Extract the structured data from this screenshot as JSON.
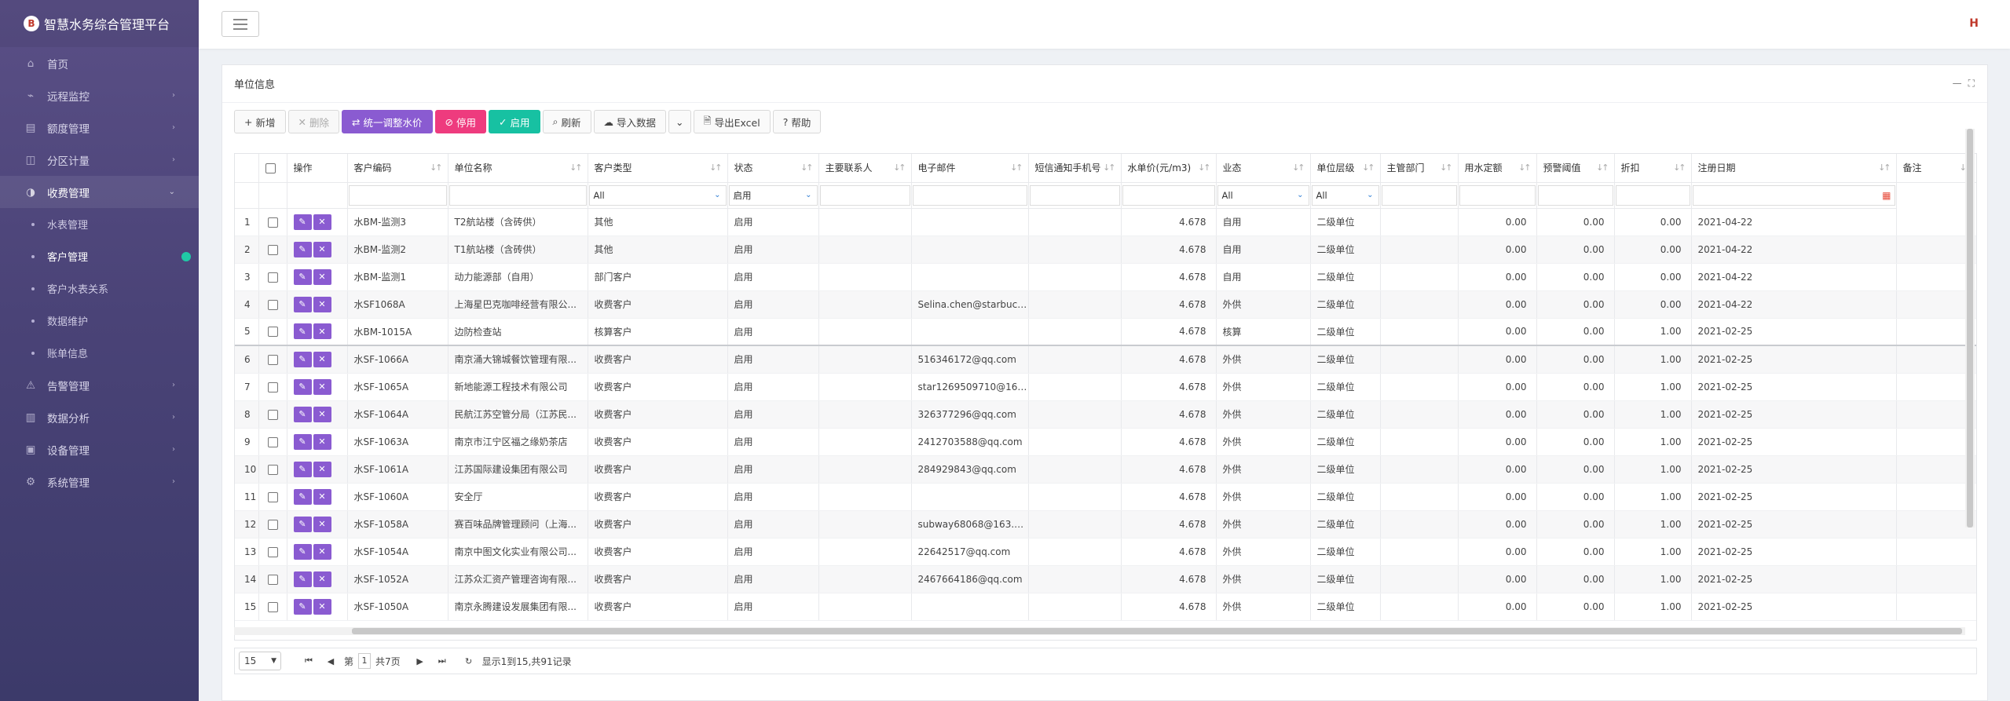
{
  "app": {
    "title": "智慧水务综合管理平台",
    "logo_text": "B"
  },
  "sidebar": {
    "items": [
      {
        "label": "首页",
        "icon": "home-icon"
      },
      {
        "label": "远程监控",
        "icon": "monitor-icon"
      },
      {
        "label": "额度管理",
        "icon": "quota-icon"
      },
      {
        "label": "分区计量",
        "icon": "partition-icon"
      },
      {
        "label": "收费管理",
        "icon": "billing-icon",
        "open": true,
        "children": [
          {
            "label": "水表管理"
          },
          {
            "label": "客户管理",
            "active": true
          },
          {
            "label": "客户水表关系"
          },
          {
            "label": "数据维护"
          },
          {
            "label": "账单信息"
          }
        ]
      },
      {
        "label": "告警管理",
        "icon": "alarm-icon"
      },
      {
        "label": "数据分析",
        "icon": "analysis-icon"
      },
      {
        "label": "设备管理",
        "icon": "device-icon"
      },
      {
        "label": "系统管理",
        "icon": "system-icon"
      }
    ]
  },
  "panel": {
    "title": "单位信息"
  },
  "toolbar": {
    "add": "新增",
    "delete": "删除",
    "adjust_price": "统一调整水价",
    "disable": "停用",
    "enable": "启用",
    "refresh": "刷新",
    "import": "导入数据",
    "export": "导出Excel",
    "help": "帮助"
  },
  "table": {
    "columns": [
      "操作",
      "客户编码",
      "单位名称",
      "客户类型",
      "状态",
      "主要联系人",
      "电子邮件",
      "短信通知手机号",
      "水单价(元/m3)",
      "业态",
      "单位层级",
      "主管部门",
      "用水定额",
      "预警阈值",
      "折扣",
      "注册日期",
      "备注"
    ],
    "filters": {
      "customer_type": "All",
      "status": "启用",
      "business_type": "All",
      "unit_level": "All"
    },
    "rows": [
      {
        "no": "1",
        "code": "水BM-监测3",
        "name": "T2航站楼（含砖供）",
        "type": "其他",
        "status": "启用",
        "email": "",
        "price": "4.678",
        "biz": "自用",
        "level": "二级单位",
        "quota": "0.00",
        "warn": "0.00",
        "discount": "0.00",
        "date": "2021-04-22"
      },
      {
        "no": "2",
        "code": "水BM-监测2",
        "name": "T1航站楼（含砖供）",
        "type": "其他",
        "status": "启用",
        "email": "",
        "price": "4.678",
        "biz": "自用",
        "level": "二级单位",
        "quota": "0.00",
        "warn": "0.00",
        "discount": "0.00",
        "date": "2021-04-22"
      },
      {
        "no": "3",
        "code": "水BM-监测1",
        "name": "动力能源部（自用）",
        "type": "部门客户",
        "status": "启用",
        "email": "",
        "price": "4.678",
        "biz": "自用",
        "level": "二级单位",
        "quota": "0.00",
        "warn": "0.00",
        "discount": "0.00",
        "date": "2021-04-22"
      },
      {
        "no": "4",
        "code": "水SF1068A",
        "name": "上海星巴克咖啡经营有限公...",
        "type": "收费客户",
        "status": "启用",
        "email": "Selina.chen@starbuck...",
        "price": "4.678",
        "biz": "外供",
        "level": "二级单位",
        "quota": "0.00",
        "warn": "0.00",
        "discount": "0.00",
        "date": "2021-04-22"
      },
      {
        "no": "5",
        "code": "水BM-1015A",
        "name": "边防检查站",
        "type": "核算客户",
        "status": "启用",
        "email": "",
        "price": "4.678",
        "biz": "核算",
        "level": "二级单位",
        "quota": "0.00",
        "warn": "0.00",
        "discount": "1.00",
        "date": "2021-02-25"
      },
      {
        "no": "6",
        "code": "水SF-1066A",
        "name": "南京涌大锦城餐饮管理有限...",
        "type": "收费客户",
        "status": "启用",
        "email": "516346172@qq.com",
        "price": "4.678",
        "biz": "外供",
        "level": "二级单位",
        "quota": "0.00",
        "warn": "0.00",
        "discount": "1.00",
        "date": "2021-02-25"
      },
      {
        "no": "7",
        "code": "水SF-1065A",
        "name": "新地能源工程技术有限公司",
        "type": "收费客户",
        "status": "启用",
        "email": "star1269509710@163...",
        "price": "4.678",
        "biz": "外供",
        "level": "二级单位",
        "quota": "0.00",
        "warn": "0.00",
        "discount": "1.00",
        "date": "2021-02-25"
      },
      {
        "no": "8",
        "code": "水SF-1064A",
        "name": "民航江苏空管分局（江苏民...",
        "type": "收费客户",
        "status": "启用",
        "email": "326377296@qq.com",
        "price": "4.678",
        "biz": "外供",
        "level": "二级单位",
        "quota": "0.00",
        "warn": "0.00",
        "discount": "1.00",
        "date": "2021-02-25"
      },
      {
        "no": "9",
        "code": "水SF-1063A",
        "name": "南京市江宁区福之缘奶茶店",
        "type": "收费客户",
        "status": "启用",
        "email": "2412703588@qq.com",
        "price": "4.678",
        "biz": "外供",
        "level": "二级单位",
        "quota": "0.00",
        "warn": "0.00",
        "discount": "1.00",
        "date": "2021-02-25"
      },
      {
        "no": "10",
        "code": "水SF-1061A",
        "name": "江苏国际建设集团有限公司",
        "type": "收费客户",
        "status": "启用",
        "email": "284929843@qq.com",
        "price": "4.678",
        "biz": "外供",
        "level": "二级单位",
        "quota": "0.00",
        "warn": "0.00",
        "discount": "1.00",
        "date": "2021-02-25"
      },
      {
        "no": "11",
        "code": "水SF-1060A",
        "name": "安全厅",
        "type": "收费客户",
        "status": "启用",
        "email": "",
        "price": "4.678",
        "biz": "外供",
        "level": "二级单位",
        "quota": "0.00",
        "warn": "0.00",
        "discount": "1.00",
        "date": "2021-02-25"
      },
      {
        "no": "12",
        "code": "水SF-1058A",
        "name": "赛百味品牌管理顾问（上海...",
        "type": "收费客户",
        "status": "启用",
        "email": "subway68068@163.c...",
        "price": "4.678",
        "biz": "外供",
        "level": "二级单位",
        "quota": "0.00",
        "warn": "0.00",
        "discount": "1.00",
        "date": "2021-02-25"
      },
      {
        "no": "13",
        "code": "水SF-1054A",
        "name": "南京中图文化实业有限公司...",
        "type": "收费客户",
        "status": "启用",
        "email": "22642517@qq.com",
        "price": "4.678",
        "biz": "外供",
        "level": "二级单位",
        "quota": "0.00",
        "warn": "0.00",
        "discount": "1.00",
        "date": "2021-02-25"
      },
      {
        "no": "14",
        "code": "水SF-1052A",
        "name": "江苏众汇资产管理咨询有限...",
        "type": "收费客户",
        "status": "启用",
        "email": "2467664186@qq.com",
        "price": "4.678",
        "biz": "外供",
        "level": "二级单位",
        "quota": "0.00",
        "warn": "0.00",
        "discount": "1.00",
        "date": "2021-02-25"
      },
      {
        "no": "15",
        "code": "水SF-1050A",
        "name": "南京永腾建设发展集团有限...",
        "type": "收费客户",
        "status": "启用",
        "email": "",
        "price": "4.678",
        "biz": "外供",
        "level": "二级单位",
        "quota": "0.00",
        "warn": "0.00",
        "discount": "1.00",
        "date": "2021-02-25"
      }
    ]
  },
  "pager": {
    "page_size": "15",
    "page_prefix": "第",
    "current_page": "1",
    "total_pages": "共7页",
    "summary": "显示1到15,共91记录"
  }
}
